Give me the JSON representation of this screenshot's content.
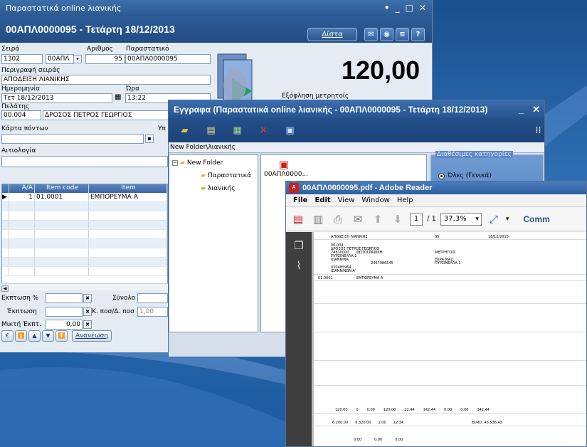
{
  "window_main": {
    "title": "Παραστατικά online λιανικής",
    "heading": "00ΑΠΛ0000095 - Τετάρτη 18/12/2013",
    "dista_label": "Δίστα",
    "header_icons": [
      "help-icon",
      "globe-icon",
      "menu-icon",
      "question-icon"
    ],
    "fields": {
      "seira_label": "Σειρά",
      "seira_value": "1302",
      "seira_code": "00ΑΠΛ",
      "arithmos_label": "Αριθμός",
      "arithmos_value": "95",
      "parastatiko_label": "Παραστατικό",
      "parastatiko_value": "00ΑΠΛ0000095",
      "perigrafi_label": "Περιγραφή σειράς",
      "perigrafi_value": "ΑΠΟΔΕΙΞΗ ΛΙΑΝΙΚΗΣ",
      "date_label": "Ημερομηνία",
      "date_value": "Τετ 18/12/2013",
      "time_label": "Ώρα",
      "time_value": "13:22",
      "client_label": "Πελάτης",
      "client_code": "00.004",
      "client_name": "ΔΡΟΣΟΣ ΠΕΤΡΟΣ ΓΕΩΡΓΙΟΣ",
      "card_label": "Κάρτα πόντων",
      "card_hint": "Υπ",
      "reason_label": "Αιτιολογία",
      "payment_label": "Εξόφληση μετρητοίς"
    },
    "amount": "120,00",
    "grid": {
      "headers": [
        "Α/Α",
        "Item code",
        "Item"
      ],
      "rows": [
        {
          "aa": "1",
          "code": "01.0001",
          "item": "ΕΜΠΟΡΕΥΜΑ Α"
        }
      ]
    },
    "footer": {
      "discount_pct_label": "Εκπτωση %",
      "total_label": "Σύνολο",
      "discount_label": "Έκπτωση",
      "qty_label": "Κ. ποσ/Δ. ποσ",
      "qty_value": "1,00",
      "mixed_label": "Μικτή Έκπτ.",
      "mixed_value": "0,00",
      "refresh_label": "Ανανέωση"
    }
  },
  "window_docs": {
    "title": "Εγγραφα (Παραστατικά online λιανικής - 00ΑΠΛ0000095 - Τετάρτη 18/12/2013)",
    "path": "New Folder\\λιανικής",
    "tree": [
      "New Folder",
      "Παραστατικά",
      "λιανικής"
    ],
    "file_name": "00ΑΠΛ0000...",
    "categories_label": "Διαθέσιμες κατηγορίες",
    "radio_label": "Όλες (Γενικά)"
  },
  "window_pdf": {
    "title": "00ΑΠΛ0000095.pdf - Adobe Reader",
    "menu": [
      "File",
      "Edit",
      "View",
      "Window",
      "Help"
    ],
    "page_current": "1",
    "page_total": "/ 1",
    "zoom": "37,3%",
    "comment_label": "Comm",
    "doc": {
      "title": "ΑΠΟΔΕΙΞΗ ΛΙΑΝΙΚΗΣ",
      "number": "95",
      "date": "18/12/2013",
      "code": "00.004",
      "name": "ΔΡΟΣΟΣ ΠΕΤΡΟΣ ΓΕΩΡΓΙΟΣ",
      "afm": "74810000",
      "profession": "ΦΩΤΟΓΡΑΦΙΚΗ",
      "street": "ΠΥΡΣΙΝΕΛΛΑ 1",
      "city": "ΙΩΑΝΝΙΝΑ",
      "phone": "2467086545",
      "payment": "ΜΕΤΡΗΤΟΙΣ",
      "seat_label": "ΕΔΡΑ ΜΑΣ",
      "seat_street": "ΠΥΡΣΙΝΕΛΛΑ 1",
      "doy": "030485964",
      "doy_city": "ΙΩΑΝΝΙΝΩΝ Α'",
      "line_code": "01.0001",
      "line_item": "ΕΜΠΟΡΕΥΜΑ Α",
      "totals_row": [
        "120.00",
        "0",
        "0.00",
        "120.00",
        "22.44",
        "142.44",
        "0.00",
        "0.00",
        "142.44"
      ],
      "summary_row": [
        "6.200.00",
        "6.320.00",
        "1.00",
        "12:34"
      ],
      "euro_label": "EURO: 46.536.43",
      "zeros": [
        "0.00",
        "0.00",
        "0.00"
      ]
    }
  }
}
